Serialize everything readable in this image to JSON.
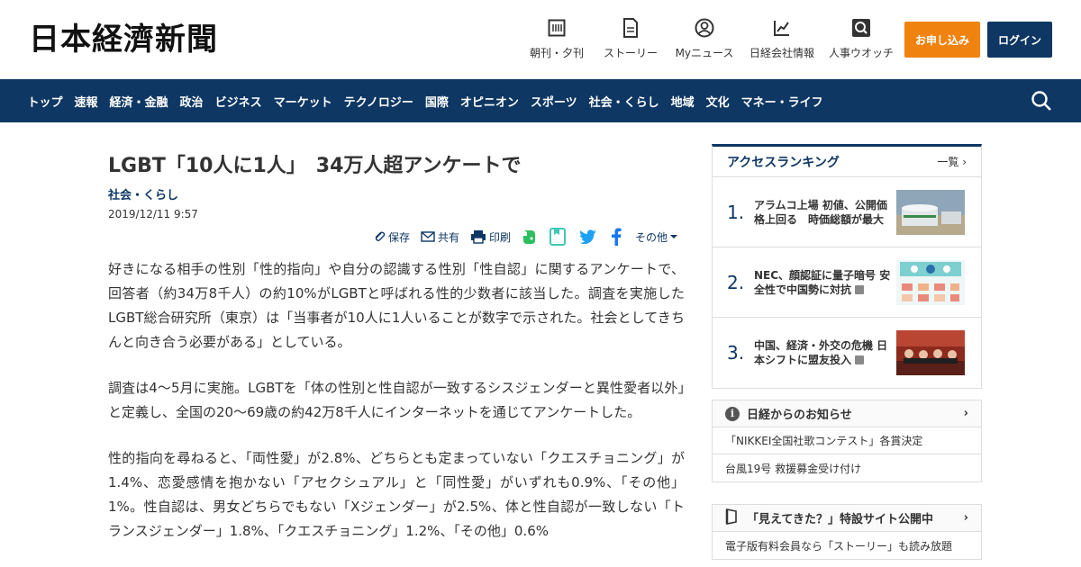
{
  "header": {
    "logo": "日本経濟新聞",
    "nav": [
      {
        "label": "朝刊・夕刊",
        "icon": "newspaper-icon"
      },
      {
        "label": "ストーリー",
        "icon": "document-icon"
      },
      {
        "label": "Myニュース",
        "icon": "user-icon"
      },
      {
        "label": "日経会社情報",
        "icon": "chart-icon"
      },
      {
        "label": "人事ウオッチ",
        "icon": "search-icon"
      }
    ],
    "apply_label": "お申し込み",
    "login_label": "ログイン"
  },
  "navbar": {
    "items": [
      "トップ",
      "速報",
      "経済・金融",
      "政治",
      "ビジネス",
      "マーケット",
      "テクノロジー",
      "国際",
      "オピニオン",
      "スポーツ",
      "社会・くらし",
      "地域",
      "文化",
      "マネー・ライフ"
    ]
  },
  "article": {
    "title": "LGBT「10人に1人」　34万人超アンケートで",
    "category": "社会・くらし",
    "date": "2019/12/11 9:57",
    "tools": {
      "save": "保存",
      "share": "共有",
      "print": "印刷",
      "more": "その他"
    },
    "paragraphs": [
      "好きになる相手の性別「性的指向」や自分の認識する性別「性自認」に関するアンケートで、回答者（約34万8千人）の約10%がLGBTと呼ばれる性的少数者に該当した。調査を実施したLGBT総合研究所（東京）は「当事者が10人に1人いることが数字で示された。社会としてきちんと向き合う必要がある」としている。",
      "調査は4～5月に実施。LGBTを「体の性別と性自認が一致するシスジェンダーと異性愛者以外」と定義し、全国の20～69歳の約42万8千人にインターネットを通じてアンケートした。",
      "性的指向を尋ねると、「両性愛」が2.8%、どちらとも定まっていない「クエスチョニング」が1.4%、恋愛感情を抱かない「アセクシュアル」と「同性愛」がいずれも0.9%、「その他」1%。性自認は、男女どちらでもない「Xジェンダー」が2.5%、体と性自認が一致しない「トランスジェンダー」1.8%、「クエスチョニング」1.2%、「その他」0.6%"
    ]
  },
  "sidebar": {
    "ranking": {
      "title": "アクセスランキング",
      "more": "一覧",
      "items": [
        {
          "num": "1.",
          "text": "アラムコ上場 初値、公開価格上回る　時価総額が最大"
        },
        {
          "num": "2.",
          "text": "NEC、顔認証に量子暗号 安全性で中国勢に対抗"
        },
        {
          "num": "3.",
          "text": "中国、経済・外交の危機 日本シフトに盟友投入"
        }
      ]
    },
    "notice": {
      "title": "日経からのお知らせ",
      "items": [
        "「NIKKEI全国社歌コンテスト」各賞決定",
        "台風19号 救援募金受け付け"
      ]
    },
    "promo": {
      "title": "「見えてきた？」特設サイト公開中",
      "items": [
        "電子版有料会員なら「ストーリー」も読み放題"
      ]
    }
  },
  "colors": {
    "brand_navy": "#0e3763",
    "apply_orange": "#f0820f"
  }
}
